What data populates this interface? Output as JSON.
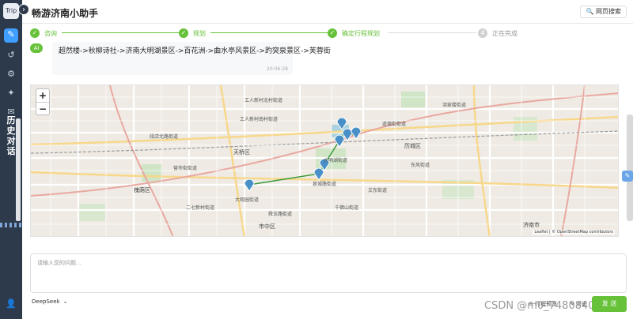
{
  "sidebar": {
    "logo_text": "Trip",
    "toggle_glyph": "›",
    "icons": [
      "chat-icon",
      "history-icon",
      "settings-icon",
      "star-icon",
      "message-icon"
    ],
    "history_label": [
      "历",
      "史",
      "对",
      "话"
    ],
    "user_icon": "user-icon"
  },
  "header": {
    "title": "畅游济南小助手",
    "web_search": "🔍 网页搜索"
  },
  "steps": [
    {
      "label": "咨询",
      "status": "done"
    },
    {
      "label": "规划",
      "status": "done"
    },
    {
      "label": "确定行程规划",
      "status": "done"
    },
    {
      "label": "正在完成",
      "status": "pending"
    }
  ],
  "chat": {
    "avatar": "AI",
    "route_text": "超然楼->秋柳诗社->济南大明湖景区->百花洲->曲水亭风景区->趵突泉景区->芙蓉街",
    "time": "20:06:28"
  },
  "map": {
    "zoom_in": "+",
    "zoom_out": "−",
    "attribution": "Leaflet | © OpenStreetMap contributors",
    "districts": [
      {
        "name": "天桥区"
      },
      {
        "name": "历城区"
      },
      {
        "name": "市中区"
      },
      {
        "name": "槐荫区"
      },
      {
        "name": "济南市"
      }
    ],
    "streets": [
      {
        "name": "工人新村北村街道"
      },
      {
        "name": "工人新村南村街道"
      },
      {
        "name": "大明湖街道"
      },
      {
        "name": "泉城路街道"
      },
      {
        "name": "大观园街道"
      },
      {
        "name": "千佛山街道"
      },
      {
        "name": "文东街道"
      },
      {
        "name": "东风街道"
      },
      {
        "name": "道德街街道"
      },
      {
        "name": "洪家楼街道"
      },
      {
        "name": "段店北路街道"
      },
      {
        "name": "营市街街道"
      },
      {
        "name": "舜玉路街道"
      },
      {
        "name": "二七新村街道"
      }
    ],
    "markers": [
      "超然楼",
      "秋柳诗社",
      "济南大明湖景区",
      "百花洲",
      "曲水亭风景区",
      "趵突泉景区",
      "芙蓉街"
    ]
  },
  "input": {
    "placeholder": "请输入您的问题..."
  },
  "footer": {
    "model": "DeepSeek",
    "watermark": "CSDN @m0_74808407",
    "btn_a": "行程预览",
    "btn_b": "历史",
    "send": "发 送"
  },
  "colors": {
    "accent": "#67c23a",
    "sidebar_bg": "#2d3a4b",
    "marker": "#4a90c8",
    "route": "#3a9a3a"
  }
}
